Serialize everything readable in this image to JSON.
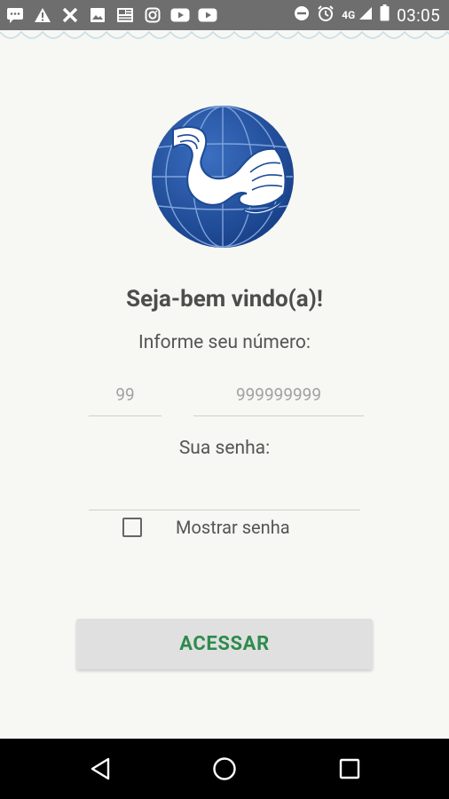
{
  "status_bar": {
    "time": "03:05",
    "network": "4G",
    "icons": [
      "message-icon",
      "warning-icon",
      "close-icon",
      "image-icon",
      "news-icon",
      "instagram-icon",
      "youtube-icon",
      "youtube-icon",
      "do-not-disturb-icon",
      "alarm-icon",
      "signal-icon",
      "battery-icon"
    ]
  },
  "login": {
    "welcome": "Seja-bem vindo(a)!",
    "phone_prompt": "Informe seu número:",
    "area_code_placeholder": "99",
    "phone_placeholder": "999999999",
    "password_prompt": "Sua senha:",
    "show_password_label": "Mostrar senha",
    "submit_label": "ACESSAR"
  },
  "colors": {
    "accent_green": "#2e8b4e",
    "logo_blue": "#1f4f9a",
    "status_bar": "#6e6e6e",
    "nav_bar": "#000000"
  },
  "nav_bar": {
    "icons": [
      "back-icon",
      "home-icon",
      "recents-icon"
    ]
  }
}
